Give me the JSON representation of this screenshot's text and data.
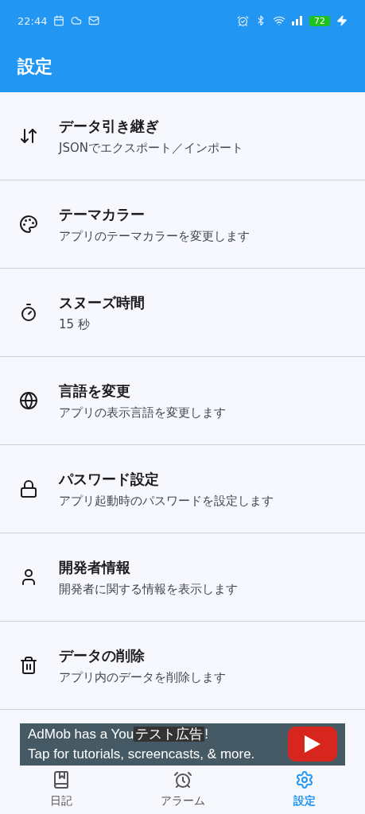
{
  "status_bar": {
    "time": "22:44",
    "battery": "72"
  },
  "app_bar": {
    "title": "設定"
  },
  "settings": [
    {
      "title": "データ引き継ぎ",
      "subtitle": "JSONでエクスポート／インポート"
    },
    {
      "title": "テーマカラー",
      "subtitle": "アプリのテーマカラーを変更します"
    },
    {
      "title": "スヌーズ時間",
      "subtitle": "15 秒"
    },
    {
      "title": "言語を変更",
      "subtitle": "アプリの表示言語を変更します"
    },
    {
      "title": "パスワード設定",
      "subtitle": "アプリ起動時のパスワードを設定します"
    },
    {
      "title": "開発者情報",
      "subtitle": "開発者に関する情報を表示します"
    },
    {
      "title": "データの削除",
      "subtitle": "アプリ内のデータを削除します"
    }
  ],
  "ad": {
    "line1": "AdMob has a You",
    "line1_end": "!",
    "line2": "Tap for tutorials, screencasts, & more.",
    "test_label": "テスト広告"
  },
  "bottom_nav": [
    {
      "label": "日記",
      "selected": false
    },
    {
      "label": "アラーム",
      "selected": false
    },
    {
      "label": "設定",
      "selected": true
    }
  ]
}
